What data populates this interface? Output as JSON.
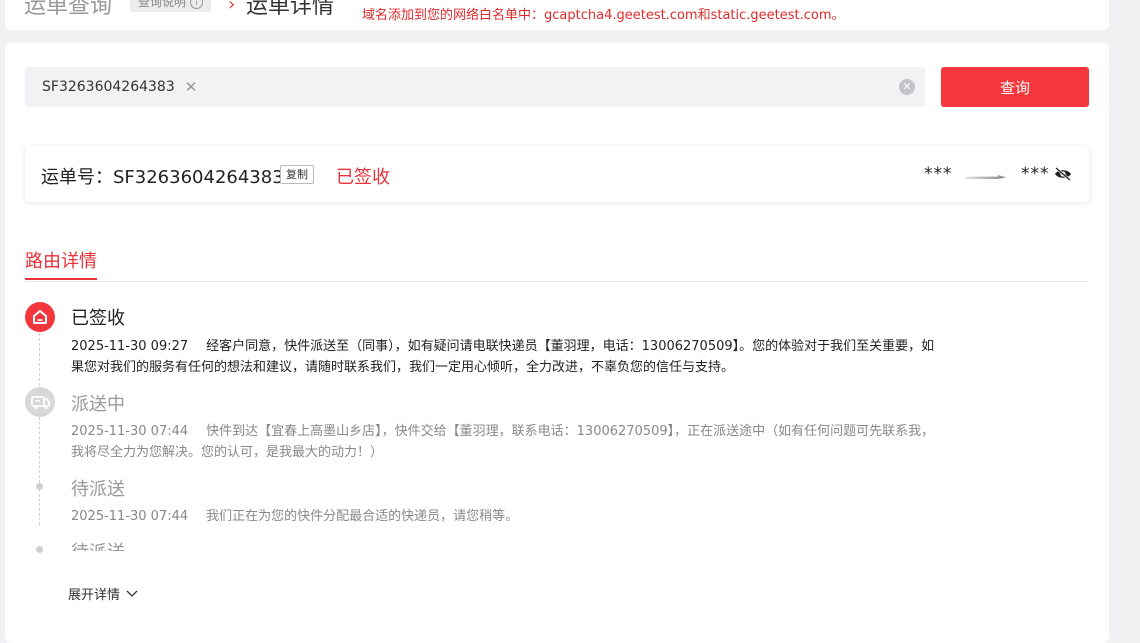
{
  "header": {
    "title": "运单查询",
    "help_label": "查询说明",
    "current": "运单详情",
    "warning": "域名添加到您的网络白名单中：gcaptcha4.geetest.com和static.geetest.com。"
  },
  "search": {
    "tag": "SF3263604264383",
    "query_button": "查询"
  },
  "waybill": {
    "label": "运单号：SF3263604264383",
    "copy_label": "复制",
    "status": "已签收",
    "from": "***",
    "to": "***"
  },
  "section": {
    "title": "路由详情"
  },
  "timeline": [
    {
      "status": "已签收",
      "time": "2025-11-30 09:27",
      "text": "经客户同意，快件派送至（同事），如有疑问请电联快递员【董羽理，电话：13006270509】。您的体验对于我们至关重要，如果您对我们的服务有任何的想法和建议，请随时联系我们，我们一定用心倾听，全力改进，不辜负您的信任与支持。"
    },
    {
      "status": "派送中",
      "time": "2025-11-30 07:44",
      "text": "快件到达【宜春上高墨山乡店】，快件交给【董羽理，联系电话：13006270509】，正在派送途中（如有任何问题可先联系我，我将尽全力为您解决。您的认可，是我最大的动力！）"
    },
    {
      "status": "待派送",
      "time": "2025-11-30 07:44",
      "text": "我们正在为您的快件分配最合适的快递员，请您稍等。"
    },
    {
      "status": "待派送"
    }
  ],
  "expand_label": "展开详情",
  "colors": {
    "accent": "#f3373c",
    "status_red": "#e8333a"
  },
  "icons": {
    "signed": "home-icon",
    "delivering": "delivery-truck-icon",
    "eye": "eye-off-icon",
    "clear": "clear-circle-icon",
    "expand": "chevron-down-icon",
    "info": "info-icon"
  }
}
